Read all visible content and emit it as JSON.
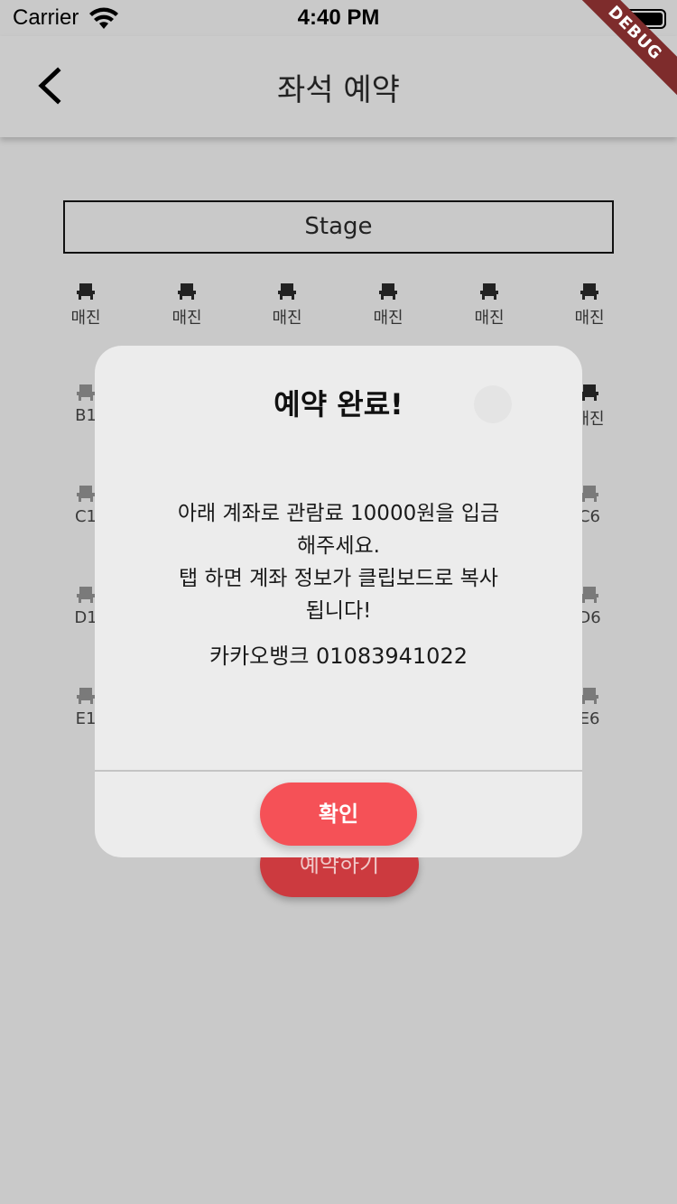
{
  "status_bar": {
    "carrier": "Carrier",
    "time": "4:40 PM"
  },
  "app_bar": {
    "title": "좌석 예약",
    "back_icon": "chevron-left-icon"
  },
  "debug_banner": "DEBUG",
  "stage": {
    "label": "Stage"
  },
  "seats": {
    "row_a": [
      "매진",
      "매진",
      "매진",
      "매진",
      "매진",
      "매진"
    ],
    "row_b": {
      "left": "B1",
      "right": "매진"
    },
    "row_c": {
      "left": "C1",
      "right": "C6"
    },
    "row_d": {
      "left": "D1",
      "right": "D6"
    },
    "row_e": {
      "left": "E1",
      "right": "E6"
    },
    "seat_icon": "seat-icon"
  },
  "reserve_button": {
    "label": "예약하기"
  },
  "dialog": {
    "title": "예약 완료!",
    "message_line1": "아래 계좌로 관람료 10000원을 입금",
    "message_line2": "해주세요.",
    "message_line3": "탭 하면 계좌 정보가 클립보드로 복사",
    "message_line4": "됩니다!",
    "account": "카카오뱅크 01083941022",
    "confirm_label": "확인"
  }
}
